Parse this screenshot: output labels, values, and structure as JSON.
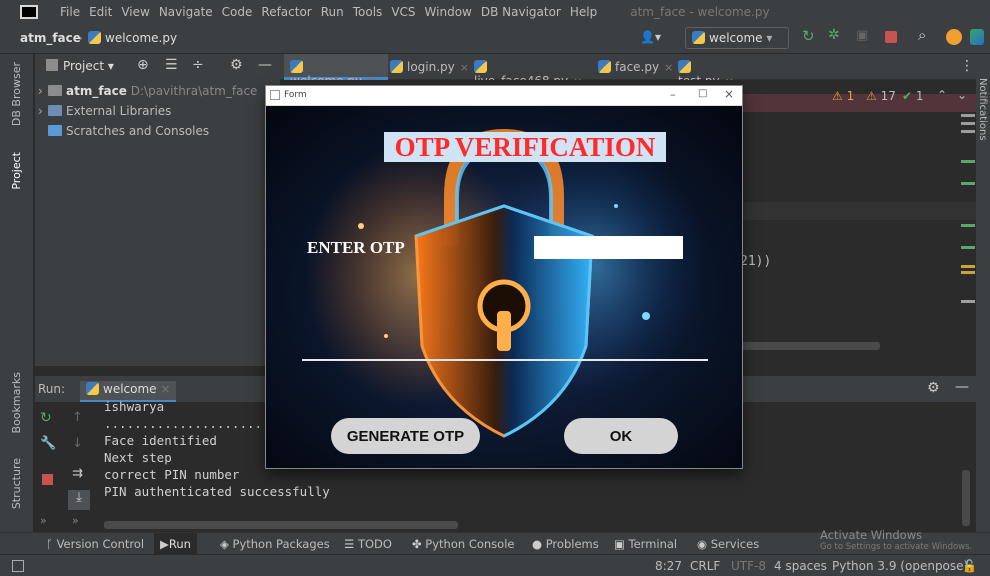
{
  "menubar": {
    "items": [
      "File",
      "Edit",
      "View",
      "Navigate",
      "Code",
      "Refactor",
      "Run",
      "Tools",
      "VCS",
      "Window",
      "DB Navigator",
      "Help"
    ],
    "window_title": "atm_face - welcome.py"
  },
  "navbar": {
    "project": "atm_face",
    "file": "welcome.py",
    "run_config": "welcome"
  },
  "leftstrip": {
    "db_browser": "DB Browser",
    "project": "Project",
    "bookmarks": "Bookmarks",
    "structure": "Structure"
  },
  "rightstrip": {
    "notifications": "Notifications"
  },
  "project_panel": {
    "header": "Project",
    "tree": [
      {
        "name": "atm_face",
        "path": "D:\\pavithra\\atm_face"
      },
      {
        "name": "External Libraries"
      },
      {
        "name": "Scratches and Consoles"
      }
    ]
  },
  "tabs": [
    "welcome.py",
    "login.py",
    "live_face468.py",
    "face.py",
    "test.py"
  ],
  "inspections": {
    "warn1": "1",
    "warn2": "17",
    "ok": "1"
  },
  "editor": {
    "visible_code_fragment": "21))"
  },
  "run_panel": {
    "label": "Run:",
    "config": "welcome",
    "console_lines": [
      "ishwarya",
      "......................",
      "Face identified",
      "Next step",
      "correct PIN number",
      "PIN authenticated successfully"
    ]
  },
  "bottom_tools": [
    "Version Control",
    "Run",
    "Python Packages",
    "TODO",
    "Python Console",
    "Problems",
    "Terminal",
    "Services"
  ],
  "activate_windows": {
    "title": "Activate Windows",
    "subtitle": "Go to Settings to activate Windows."
  },
  "statusbar": {
    "position": "8:27",
    "line_sep": "CRLF",
    "encoding": "UTF-8",
    "indent": "4 spaces",
    "interpreter": "Python 3.9 (openpose)"
  },
  "form": {
    "window_title": "Form",
    "heading": "OTP VERIFICATION",
    "enter_label": "ENTER OTP",
    "otp_value": "",
    "generate_label": "GENERATE OTP",
    "ok_label": "OK"
  }
}
